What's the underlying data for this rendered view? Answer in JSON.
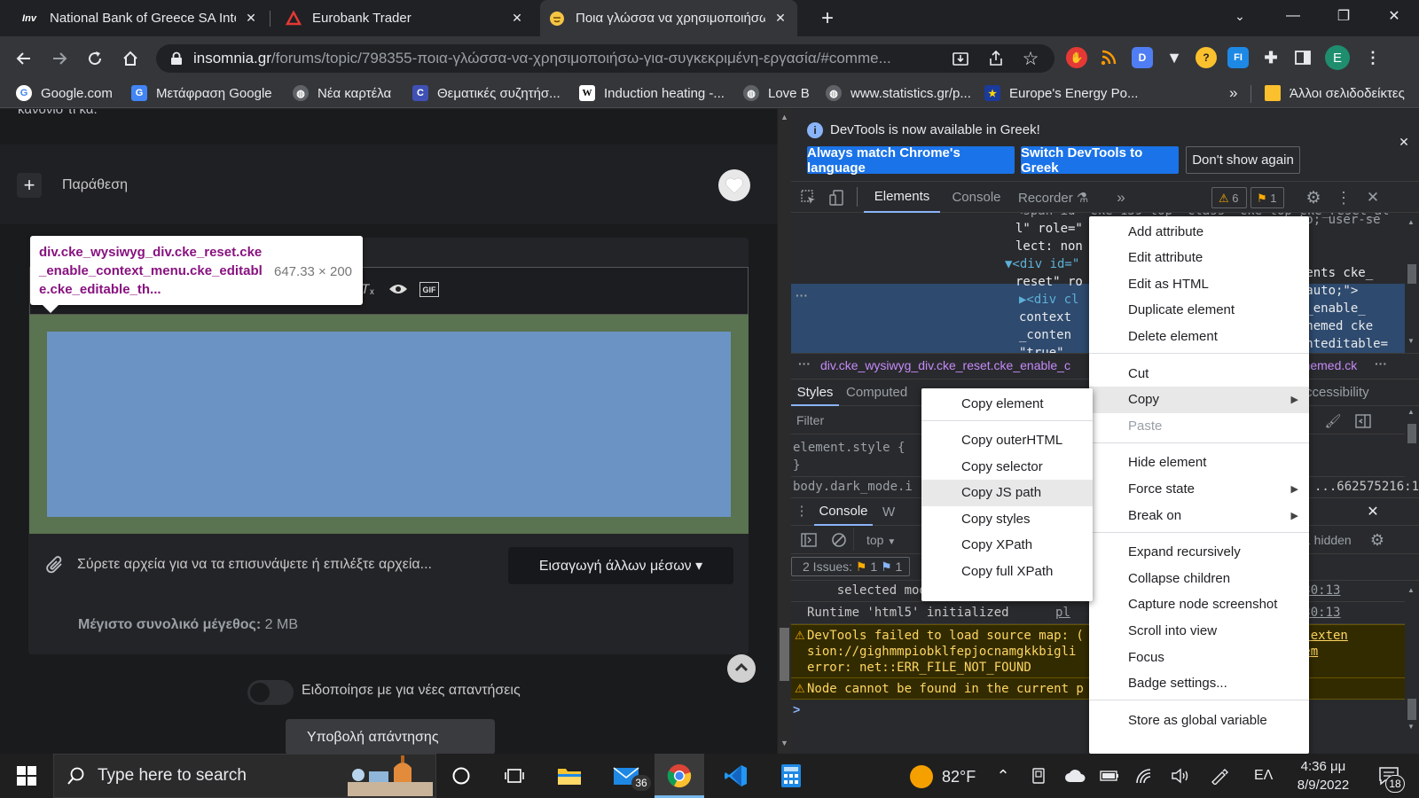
{
  "tabs": [
    {
      "label": "National Bank of Greece SA Inter",
      "favicon": "Inv",
      "favicon_color": "#ffffff",
      "favicon_bg": "#202124"
    },
    {
      "label": "Eurobank Trader",
      "favicon": "triangle-logo",
      "favicon_color": "#e53935"
    },
    {
      "label": "Ποια γλώσσα να χρησιμοποιήσω",
      "favicon": "smiley",
      "favicon_color": "#f6c544"
    }
  ],
  "window_controls": {
    "minimize": "—",
    "restore": "❐",
    "close": "✕"
  },
  "address_bar": {
    "domain": "insomnia.gr",
    "path": "/forums/topic/798355-ποια-γλώσσα-να-χρησιμοποιήσω-για-συγκεκριμένη-εργασία/#comme..."
  },
  "profile_initial": "E",
  "bookmarks": [
    {
      "label": "Google.com",
      "icon": "G"
    },
    {
      "label": "Μετάφραση Google",
      "icon": "G"
    },
    {
      "label": "Νέα καρτέλα",
      "icon": "globe"
    },
    {
      "label": "Θεματικές συζητήσ...",
      "icon": "C"
    },
    {
      "label": "Induction heating -...",
      "icon": "W"
    },
    {
      "label": "Love B",
      "icon": "globe"
    },
    {
      "label": "www.statistics.gr/p...",
      "icon": "globe"
    },
    {
      "label": "Europe's Energy Po...",
      "icon": "star"
    }
  ],
  "bookmarks_overflow": "»",
  "other_bookmarks": "Άλλοι σελιδοδείκτες",
  "page": {
    "top_cut_text": "κανόνισ τι κα.",
    "quote_label": "Παράθεση",
    "tooltip_selector": "div.cke_wysiwyg_div.cke_reset.cke_enable_context_menu.cke_editable.cke_editable_th...",
    "tooltip_size": "647.33 × 200",
    "attach_text": "Σύρετε αρχεία για να τα επισυνάψετε ή επιλέξτε αρχεία...",
    "insert_media_button": "Εισαγωγή άλλων μέσων ▾",
    "max_size_label": "Μέγιστο συνολικό μέγεθος:",
    "max_size_value": "2 MB",
    "notify_label": "Ειδοποίησε με για νέες απαντήσεις",
    "submit_button": "Υποβολή απάντησης",
    "gif_label": "GIF"
  },
  "devtools": {
    "banner_text": "DevTools is now available in Greek!",
    "banner_btn1": "Always match Chrome's language",
    "banner_btn2": "Switch DevTools to Greek",
    "banner_btn3": "Don't show again",
    "tabs": [
      "Elements",
      "Console",
      "Recorder"
    ],
    "more_tabs": "»",
    "warnings": "6",
    "issues": "1",
    "dom_lines": [
      "<span id=\"cke_159_top\" class=\"cke_top cke_reset_al",
      "l\" role=\"",
      "lect: non",
      "▼<div id=\"",
      "reset\" ro",
      "▶<div cl",
      "context",
      "_conten",
      "\"true\""
    ],
    "dom_right": [
      "auto; user-se",
      "ontents cke_",
      "t: auto;\">",
      "cke_enable_",
      "e_themed cke",
      "ntenteditable=",
      "=\"1\""
    ],
    "breadcrumb": "div.cke_wysiwyg_div.cke_reset.cke_enable_c",
    "breadcrumb_right": "le_themed.ck",
    "styles_tabs": [
      "Styles",
      "Computed"
    ],
    "accessibility_tab": "Accessibility",
    "filter_placeholder": "Filter",
    "element_style": "element.style {",
    "element_style_close": "}",
    "body_rule": "body.dark_mode.i",
    "body_rule_right": "...662575216:1",
    "drawer_tabs": [
      "Console",
      "W"
    ],
    "context_select": "top",
    "hidden_count": "1 hidden",
    "issues_label": "2 Issues:",
    "issue_warn": "1",
    "issue_info": "1",
    "console_lines": [
      {
        "text": "    selected mode: browser",
        "src": "pl",
        "src_right": "39430:13",
        "type": "log"
      },
      {
        "text": "Runtime 'html5' initialized",
        "src": "pl",
        "src_right": "39430:13",
        "type": "log"
      },
      {
        "text": "DevTools failed to load source map: (\nsion://gighmmpiobklfepjocnamgkkbigli\nerror: net::ERR_FILE_NOT_FOUND",
        "src": "",
        "src_right": "ome-exten\nystem",
        "type": "warn"
      },
      {
        "text": "Node cannot be found in the current p",
        "src": "",
        "src_right": "",
        "type": "warn"
      }
    ],
    "prompt": ">"
  },
  "main_menu": [
    {
      "label": "Add attribute"
    },
    {
      "label": "Edit attribute"
    },
    {
      "label": "Edit as HTML"
    },
    {
      "label": "Duplicate element"
    },
    {
      "label": "Delete element"
    },
    {
      "sep": true
    },
    {
      "label": "Cut"
    },
    {
      "label": "Copy",
      "submenu": true,
      "highlight": true
    },
    {
      "label": "Paste",
      "disabled": true
    },
    {
      "sep": true
    },
    {
      "label": "Hide element"
    },
    {
      "label": "Force state",
      "submenu": true
    },
    {
      "label": "Break on",
      "submenu": true
    },
    {
      "sep": true
    },
    {
      "label": "Expand recursively"
    },
    {
      "label": "Collapse children"
    },
    {
      "label": "Capture node screenshot"
    },
    {
      "label": "Scroll into view"
    },
    {
      "label": "Focus"
    },
    {
      "label": "Badge settings..."
    },
    {
      "sep": true
    },
    {
      "label": "Store as global variable"
    }
  ],
  "copy_menu": [
    {
      "label": "Copy element"
    },
    {
      "sep": true
    },
    {
      "label": "Copy outerHTML"
    },
    {
      "label": "Copy selector"
    },
    {
      "label": "Copy JS path",
      "highlight": true
    },
    {
      "label": "Copy styles"
    },
    {
      "label": "Copy XPath"
    },
    {
      "label": "Copy full XPath"
    }
  ],
  "taskbar": {
    "search_placeholder": "Type here to search",
    "mail_badge": "36",
    "temperature": "82°F",
    "language": "ΕΛ",
    "time": "4:36 μμ",
    "date": "8/9/2022",
    "notif_count": "18"
  }
}
